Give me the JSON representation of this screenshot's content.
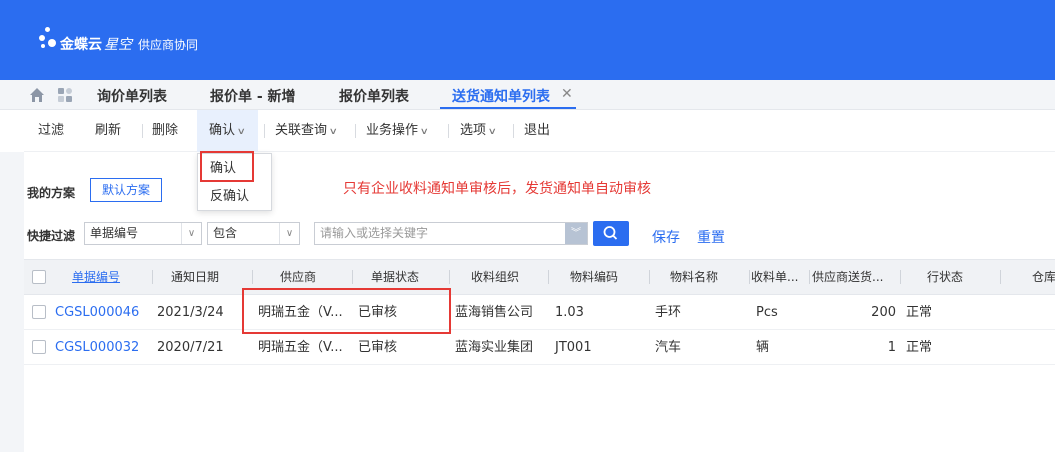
{
  "app": {
    "brand_name": "金蝶云",
    "brand_sub": "星空",
    "product": "供应商协同"
  },
  "tabs": [
    {
      "label": "询价单列表"
    },
    {
      "label": "报价单 - 新增"
    },
    {
      "label": "报价单列表"
    },
    {
      "label": "送货通知单列表",
      "active": true
    }
  ],
  "toolbar": {
    "filter": "过滤",
    "refresh": "刷新",
    "delete": "删除",
    "confirm": "确认",
    "related_query": "关联查询",
    "business_ops": "业务操作",
    "options": "选项",
    "exit": "退出"
  },
  "dropdown": {
    "items": [
      "确认",
      "反确认"
    ]
  },
  "scheme": {
    "label": "我的方案",
    "default_button": "默认方案"
  },
  "note": "只有企业收料通知单审核后，发货通知单自动审核",
  "quick_filter": {
    "label": "快捷过滤",
    "field": "单据编号",
    "operator": "包含",
    "placeholder": "请输入或选择关键字",
    "save": "保存",
    "reset": "重置"
  },
  "table": {
    "columns": [
      "单据编号",
      "通知日期",
      "供应商",
      "单据状态",
      "收料组织",
      "物料编码",
      "物料名称",
      "收料单...",
      "供应商送货...",
      "行状态",
      "仓库"
    ],
    "rows": [
      [
        "CGSL000046",
        "2021/3/24",
        "明瑞五金（V...",
        "已审核",
        "蓝海销售公司",
        "1.03",
        "手环",
        "Pcs",
        "200",
        "正常"
      ],
      [
        "CGSL000032",
        "2020/7/21",
        "明瑞五金（V...",
        "已审核",
        "蓝海实业集团",
        "JT001",
        "汽车",
        "辆",
        "1",
        "正常"
      ]
    ]
  },
  "colors": {
    "primary": "#2b6df0",
    "annotation": "#e53935"
  }
}
